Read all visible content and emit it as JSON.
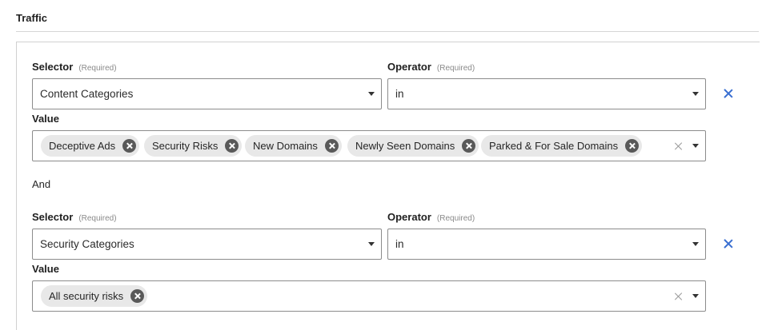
{
  "section": {
    "title": "Traffic"
  },
  "rules": [
    {
      "selector_label": "Selector",
      "selector_required": "(Required)",
      "selector_value": "Content Categories",
      "operator_label": "Operator",
      "operator_required": "(Required)",
      "operator_value": "in",
      "value_label": "Value",
      "chips": [
        "Deceptive Ads",
        "Security Risks",
        "New Domains",
        "Newly Seen Domains",
        "Parked & For Sale Domains"
      ],
      "remove_icon": "close-icon"
    },
    {
      "selector_label": "Selector",
      "selector_required": "(Required)",
      "selector_value": "Security Categories",
      "operator_label": "Operator",
      "operator_required": "(Required)",
      "operator_value": "in",
      "value_label": "Value",
      "chips": [
        "All security risks"
      ],
      "remove_icon": "close-icon"
    }
  ],
  "conjunction": "And",
  "colors": {
    "remove_icon": "#3a6fd1",
    "chip_bg": "#e8e8e8",
    "chip_close_bg": "#595959",
    "border": "#8c8c8c"
  }
}
